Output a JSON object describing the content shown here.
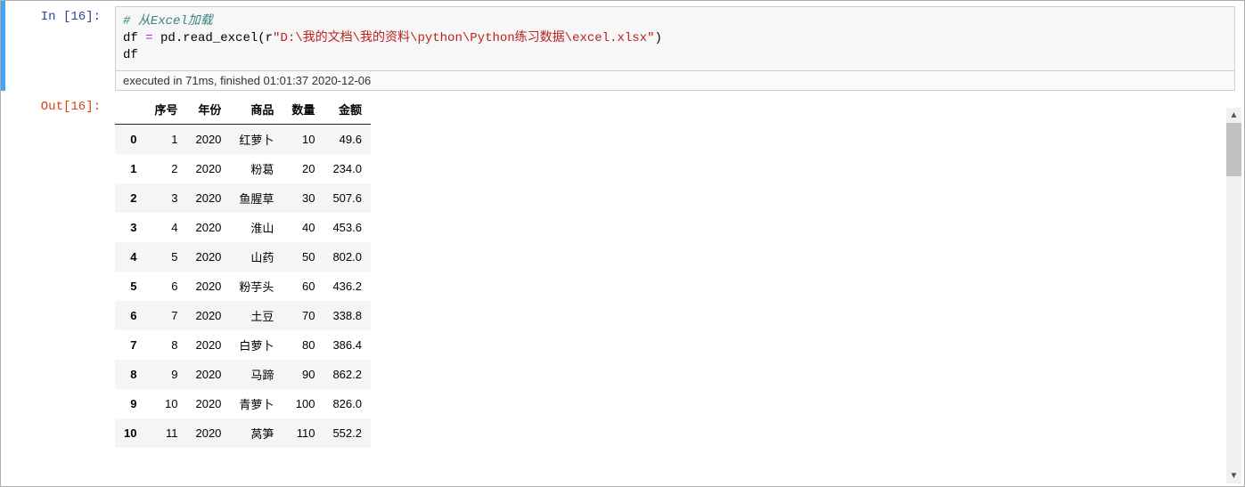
{
  "in_prompt": "In  [16]:",
  "out_prompt": "Out[16]:",
  "code": {
    "comment": "# 从Excel加载",
    "line2_pre": "df ",
    "line2_op": "=",
    "line2_mid": " pd.read_excel(r",
    "line2_str": "\"D:\\我的文档\\我的资料\\python\\Python练习数据\\excel.xlsx\"",
    "line2_post": ")",
    "line3": "df"
  },
  "exec_info": "executed in 71ms, finished 01:01:37 2020-12-06",
  "table": {
    "columns": [
      "",
      "序号",
      "年份",
      "商品",
      "数量",
      "金额"
    ],
    "rows": [
      [
        "0",
        "1",
        "2020",
        "红萝卜",
        "10",
        "49.6"
      ],
      [
        "1",
        "2",
        "2020",
        "粉葛",
        "20",
        "234.0"
      ],
      [
        "2",
        "3",
        "2020",
        "鱼腥草",
        "30",
        "507.6"
      ],
      [
        "3",
        "4",
        "2020",
        "淮山",
        "40",
        "453.6"
      ],
      [
        "4",
        "5",
        "2020",
        "山药",
        "50",
        "802.0"
      ],
      [
        "5",
        "6",
        "2020",
        "粉芋头",
        "60",
        "436.2"
      ],
      [
        "6",
        "7",
        "2020",
        "土豆",
        "70",
        "338.8"
      ],
      [
        "7",
        "8",
        "2020",
        "白萝卜",
        "80",
        "386.4"
      ],
      [
        "8",
        "9",
        "2020",
        "马蹄",
        "90",
        "862.2"
      ],
      [
        "9",
        "10",
        "2020",
        "青萝卜",
        "100",
        "826.0"
      ],
      [
        "10",
        "11",
        "2020",
        "莴笋",
        "110",
        "552.2"
      ]
    ]
  }
}
